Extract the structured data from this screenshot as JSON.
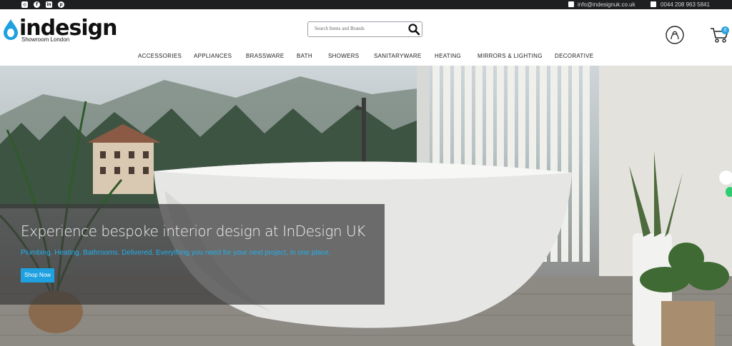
{
  "topbar": {
    "social": [
      {
        "name": "instagram",
        "glyph": "◎"
      },
      {
        "name": "facebook",
        "glyph": "f"
      },
      {
        "name": "linkedin",
        "glyph": "in"
      },
      {
        "name": "pinterest",
        "glyph": "p"
      }
    ],
    "email": "info@indesignuk.co.uk",
    "phone": "0044 208 963 5841"
  },
  "header": {
    "logo_text": "indesign",
    "logo_subtitle": "Showroom London",
    "search_placeholder": "Search Items and Brands",
    "cart_count": "0"
  },
  "nav": [
    "ACCESSORIES",
    "APPLIANCES",
    "BRASSWARE",
    "BATH",
    "SHOWERS",
    "SANITARYWARE",
    "HEATING",
    "MIRRORS & LIGHTING",
    "DECORATIVE"
  ],
  "hero": {
    "title": "Experience bespoke interior design at InDesign UK",
    "subtitle": "Plumbing. Heating. Bathrooms. Delivered. Everything you need for your next project, in one place.",
    "button": "Shop Now"
  },
  "colors": {
    "accent": "#1fa0e0",
    "topbar": "#1d1f21",
    "logo_drop": "#1fa0e0"
  }
}
